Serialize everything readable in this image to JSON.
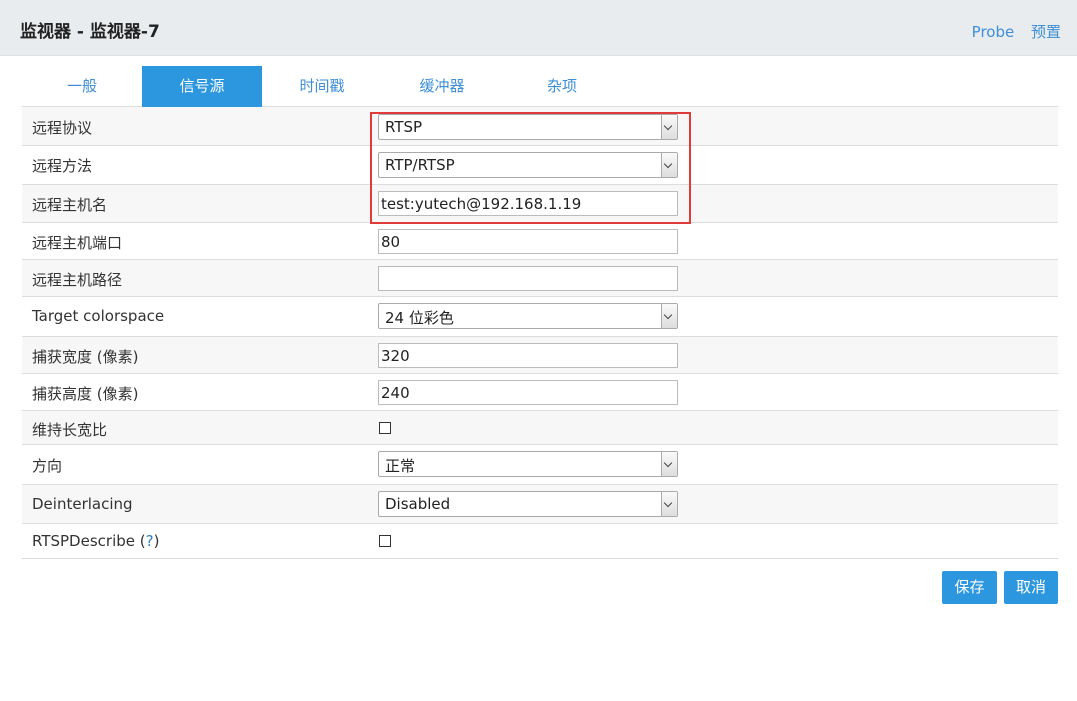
{
  "header": {
    "title": "监视器 - 监视器-7",
    "links": [
      "Probe",
      "预置"
    ]
  },
  "tabs": [
    {
      "label": "一般",
      "active": false
    },
    {
      "label": "信号源",
      "active": true
    },
    {
      "label": "时间戳",
      "active": false
    },
    {
      "label": "缓冲器",
      "active": false
    },
    {
      "label": "杂项",
      "active": false
    }
  ],
  "fields": {
    "remote_protocol": {
      "label": "远程协议",
      "value": "RTSP"
    },
    "remote_method": {
      "label": "远程方法",
      "value": "RTP/RTSP"
    },
    "remote_host": {
      "label": "远程主机名",
      "value": "test:yutech@192.168.1.19"
    },
    "remote_port": {
      "label": "远程主机端口",
      "value": "80"
    },
    "remote_path": {
      "label": "远程主机路径",
      "value": ""
    },
    "colorspace": {
      "label": "Target colorspace",
      "value": "24 位彩色"
    },
    "width": {
      "label": "捕获宽度 (像素)",
      "value": "320"
    },
    "height": {
      "label": "捕获高度 (像素)",
      "value": "240"
    },
    "aspect": {
      "label": "维持长宽比",
      "checked": false
    },
    "orientation": {
      "label": "方向",
      "value": "正常"
    },
    "deinterlacing": {
      "label": "Deinterlacing",
      "value": "Disabled"
    },
    "rtsp_describe": {
      "label": "RTSPDescribe",
      "help_open": " (",
      "help_mark": "?",
      "help_close": ")",
      "checked": false
    }
  },
  "buttons": {
    "save": "保存",
    "cancel": "取消"
  },
  "colors": {
    "accent": "#2c97de",
    "link": "#3e8fd6",
    "highlight": "#e03a3a"
  }
}
